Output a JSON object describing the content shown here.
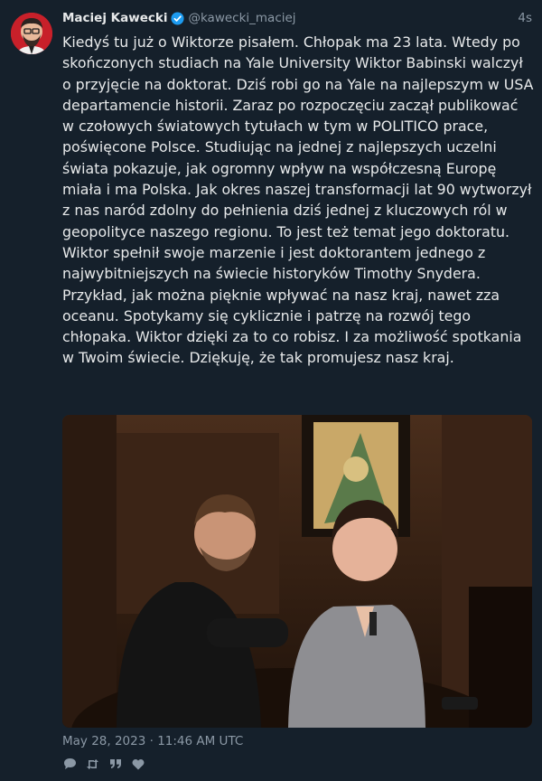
{
  "author": {
    "display_name": "Maciej Kawecki",
    "handle": "@kawecki_maciej",
    "verified": true
  },
  "timestamp_relative": "4s",
  "tweet_text": "Kiedyś tu już o Wiktorze pisałem. Chłopak ma 23 lata. Wtedy po skończonych studiach na Yale University Wiktor Babinski walczył o przyjęcie na doktorat. Dziś robi go na Yale na najlepszym w USA departamencie historii. Zaraz po rozpoczęciu zaczął publikować w czołowych światowych tytułach w tym w POLITICO prace, poświęcone Polsce. Studiując na jednej z najlepszych uczelni świata pokazuje, jak ogromny wpływ na współczesną Europę miała i ma Polska. Jak okres naszej transformacji lat 90 wytworzył z nas naród zdolny do pełnienia dziś jednej z kluczowych ról w geopolityce naszego regionu. To jest też temat jego doktoratu. Wiktor spełnił swoje marzenie i jest doktorantem jednego z najwybitniejszych na świecie historyków Timothy Snydera. Przykład, jak można pięknie wpływać na nasz kraj, nawet zza oceanu. Spotykamy się cyklicznie i patrzę na rozwój tego chłopaka. Wiktor dzięki za to co robisz. I za możliwość spotkania w Twoim świecie. Dziękuję, że tak promujesz nasz kraj.",
  "date_line": "May 28, 2023 · 11:46 AM UTC",
  "colors": {
    "background": "#15202b",
    "text": "#e7e9ea",
    "secondary": "#8b98a5",
    "verified": "#1d9bf0",
    "avatar_bg": "#c8202a"
  },
  "icons": [
    "reply-icon",
    "retweet-icon",
    "quote-icon",
    "like-icon"
  ]
}
